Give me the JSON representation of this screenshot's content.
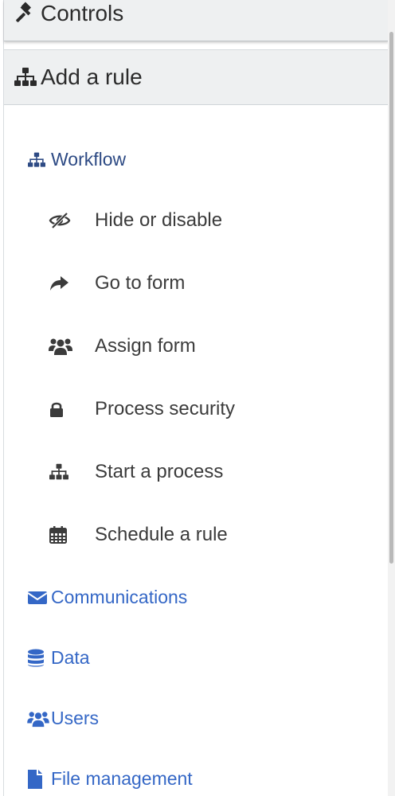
{
  "headers": {
    "controls": {
      "label": "Controls",
      "icon": "gavel-icon"
    },
    "add_rule": {
      "label": "Add a rule",
      "icon": "sitemap-icon"
    }
  },
  "sections": {
    "workflow": {
      "label": "Workflow",
      "icon": "sitemap-icon",
      "active": true
    },
    "communications": {
      "label": "Communications",
      "icon": "envelope-icon"
    },
    "data": {
      "label": "Data",
      "icon": "database-icon"
    },
    "users": {
      "label": "Users",
      "icon": "users-icon"
    },
    "file_management": {
      "label": "File management",
      "icon": "file-icon"
    }
  },
  "workflow_items": [
    {
      "label": "Hide or disable",
      "icon": "eye-slash-icon"
    },
    {
      "label": "Go to form",
      "icon": "share-arrow-icon"
    },
    {
      "label": "Assign form",
      "icon": "users-icon"
    },
    {
      "label": "Process security",
      "icon": "lock-icon"
    },
    {
      "label": "Start a process",
      "icon": "sitemap-icon"
    },
    {
      "label": "Schedule a rule",
      "icon": "calendar-icon"
    }
  ],
  "colors": {
    "header_bg": "#eef0f1",
    "section_link": "#3467c6",
    "section_active": "#2d4a84",
    "item_text": "#3b3b3b"
  }
}
